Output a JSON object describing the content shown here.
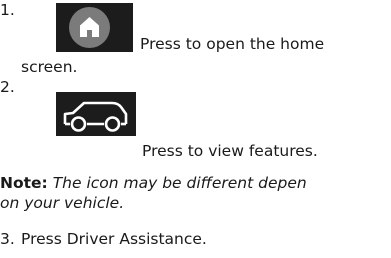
{
  "steps": [
    {
      "num": "1.",
      "icon": "home-icon",
      "text": "Press to open the home",
      "text_cont": "screen."
    },
    {
      "num": "2.",
      "icon": "vehicle-features-icon",
      "text": "Press to view features."
    },
    {
      "num": "3.",
      "text": "Press Driver Assistance."
    }
  ],
  "note": {
    "label": "Note:",
    "text": "The icon may be different depen",
    "text_cont": "on your vehicle."
  },
  "colors": {
    "icon_bg": "#1c1c1c",
    "home_circle": "#7b7b7b"
  }
}
